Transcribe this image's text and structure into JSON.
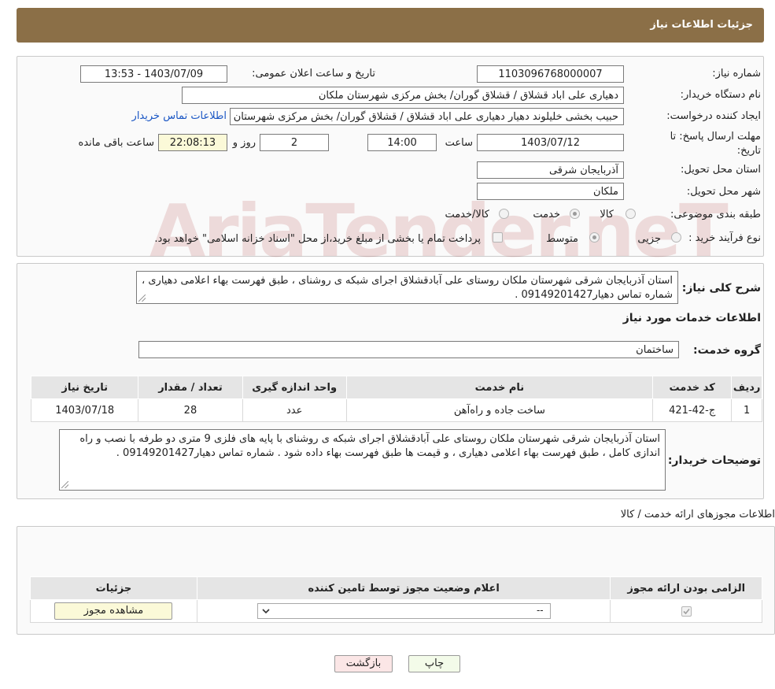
{
  "header": {
    "title": "جزئیات اطلاعات نیاز"
  },
  "details": {
    "need_number_label": "شماره نیاز:",
    "need_number": "1103096768000007",
    "announce_label": "تاریخ و ساعت اعلان عمومی:",
    "announce_value": "1403/07/09 - 13:53",
    "buyer_org_label": "نام دستگاه خریدار:",
    "buyer_org": "دهیاری علی اباد قشلاق / قشلاق گوران/ بخش مرکزی شهرستان ملکان",
    "requester_label": "ایجاد کننده درخواست:",
    "requester": "حبیب بخشی خلیلوند دهیار دهیاری علی اباد قشلاق / قشلاق گوران/ بخش مرکزی شهرستان ملکان",
    "contact_link": "اطلاعات تماس خریدار",
    "deadline_label": "مهلت ارسال پاسخ: تا تاریخ:",
    "deadline_date": "1403/07/12",
    "time_label": "ساعت",
    "deadline_time": "14:00",
    "days_value": "2",
    "days_label": "روز و",
    "remaining_time": "22:08:13",
    "remaining_label": "ساعت باقی مانده",
    "province_label": "استان محل تحویل:",
    "province": "آذربایجان شرقی",
    "city_label": "شهر محل تحویل:",
    "city": "ملکان",
    "category_label": "طبقه بندی موضوعی:",
    "category_options": [
      "کالا",
      "خدمت",
      "کالا/خدمت"
    ],
    "process_label": "نوع فرآیند خرید :",
    "process_options": [
      "جزیی",
      "متوسط"
    ],
    "payment_note": "پرداخت تمام یا بخشی از مبلغ خرید،از محل \"اسناد خزانه اسلامی\" خواهد بود."
  },
  "summary": {
    "label": "شرح کلی نیاز:",
    "text": "استان آذربایجان شرقی شهرستان ملکان روستای علی آبادقشلاق اجرای شبکه ی روشنای ، طبق فهرست بهاء اعلامی دهیاری ، شماره تماس دهیار09149201427 ."
  },
  "services": {
    "section_title": "اطلاعات خدمات مورد نیاز",
    "group_label": "گروه خدمت:",
    "group_value": "ساختمان",
    "columns": [
      "ردیف",
      "کد خدمت",
      "نام خدمت",
      "واحد اندازه گیری",
      "تعداد / مقدار",
      "تاریخ نیاز"
    ],
    "rows": [
      [
        "1",
        "ج-42-421",
        "ساخت جاده و راه‌آهن",
        "عدد",
        "28",
        "1403/07/18"
      ]
    ]
  },
  "buyer_notes": {
    "label": "توضیحات خریدار:",
    "text": "استان آذربایجان شرقی شهرستان ملکان روستای علی آبادقشلاق اجرای شبکه ی روشنای با پایه های فلزی 9 متری دو طرفه با نصب و راه اندازی کامل ، طبق فهرست بهاء اعلامی دهیاری ، و قیمت ها طبق فهرست بهاء داده شود . شماره تماس دهیار09149201427 ."
  },
  "permits": {
    "section_title": "اطلاعات مجوزهای ارائه خدمت / کالا",
    "columns": [
      "الزامی بودن ارائه مجوز",
      "اعلام وضعیت مجوز توسط تامین کننده",
      "جزئیات"
    ],
    "select_value": "--",
    "view_button": "مشاهده مجوز"
  },
  "footer": {
    "print_button": "چاپ",
    "back_button": "بازگشت"
  },
  "watermark": "AriaTender.neT"
}
